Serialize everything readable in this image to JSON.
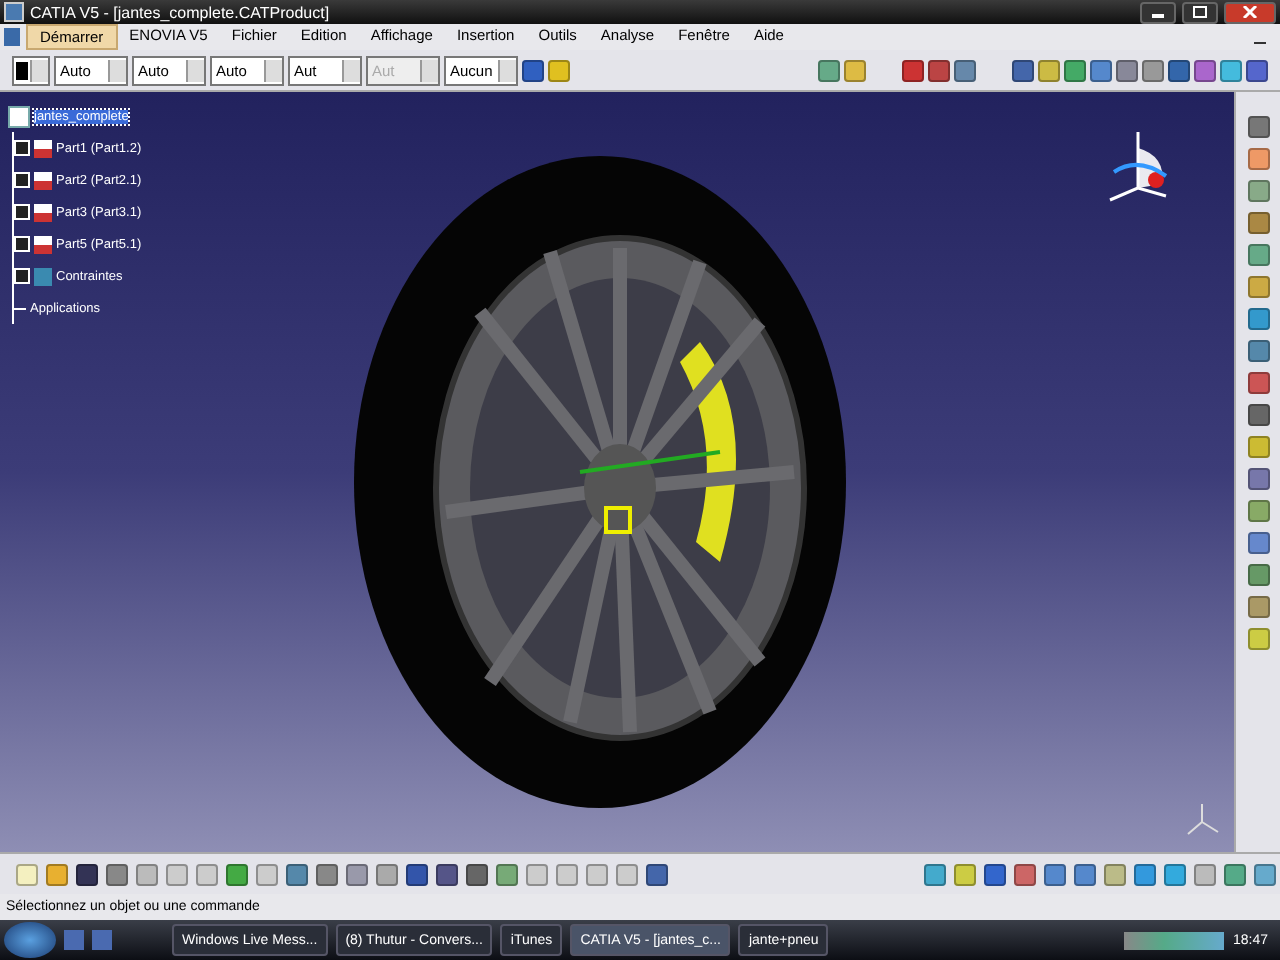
{
  "window": {
    "title": "CATIA V5 - [jantes_complete.CATProduct]"
  },
  "menu": [
    {
      "label": "Démarrer",
      "selected": true
    },
    {
      "label": "ENOVIA V5",
      "selected": false
    },
    {
      "label": "Fichier",
      "selected": false
    },
    {
      "label": "Edition",
      "selected": false
    },
    {
      "label": "Affichage",
      "selected": false
    },
    {
      "label": "Insertion",
      "selected": false
    },
    {
      "label": "Outils",
      "selected": false
    },
    {
      "label": "Analyse",
      "selected": false
    },
    {
      "label": "Fenêtre",
      "selected": false
    },
    {
      "label": "Aide",
      "selected": false
    }
  ],
  "properties_toolbar": [
    {
      "value": "Auto",
      "disabled": false
    },
    {
      "value": "Auto",
      "disabled": false
    },
    {
      "value": "Auto",
      "disabled": false
    },
    {
      "value": "Aut",
      "disabled": false
    },
    {
      "value": "Aut",
      "disabled": true
    },
    {
      "value": "Aucun",
      "disabled": false
    }
  ],
  "tree": {
    "label": "jantes_complete",
    "selected": true,
    "children": [
      {
        "label": "Part1 (Part1.2)",
        "kind": "part",
        "selected": false
      },
      {
        "label": "Part2 (Part2.1)",
        "kind": "part",
        "selected": false
      },
      {
        "label": "Part3 (Part3.1)",
        "kind": "part",
        "selected": false
      },
      {
        "label": "Part5 (Part5.1)",
        "kind": "part",
        "selected": false
      },
      {
        "label": "Contraintes",
        "kind": "constraints",
        "selected": false
      },
      {
        "label": "Applications",
        "kind": "plain",
        "selected": false
      }
    ]
  },
  "status_bar": {
    "text": "Sélectionnez un objet ou une commande"
  },
  "taskbar": {
    "items": [
      {
        "label": "Windows Live Mess...",
        "selected": false
      },
      {
        "label": "(8) Thutur - Convers...",
        "selected": false
      },
      {
        "label": "iTunes",
        "selected": false
      },
      {
        "label": "CATIA V5 - [jantes_c...",
        "selected": true
      },
      {
        "label": "jante+pneu",
        "selected": false
      }
    ],
    "clock": "18:47"
  }
}
